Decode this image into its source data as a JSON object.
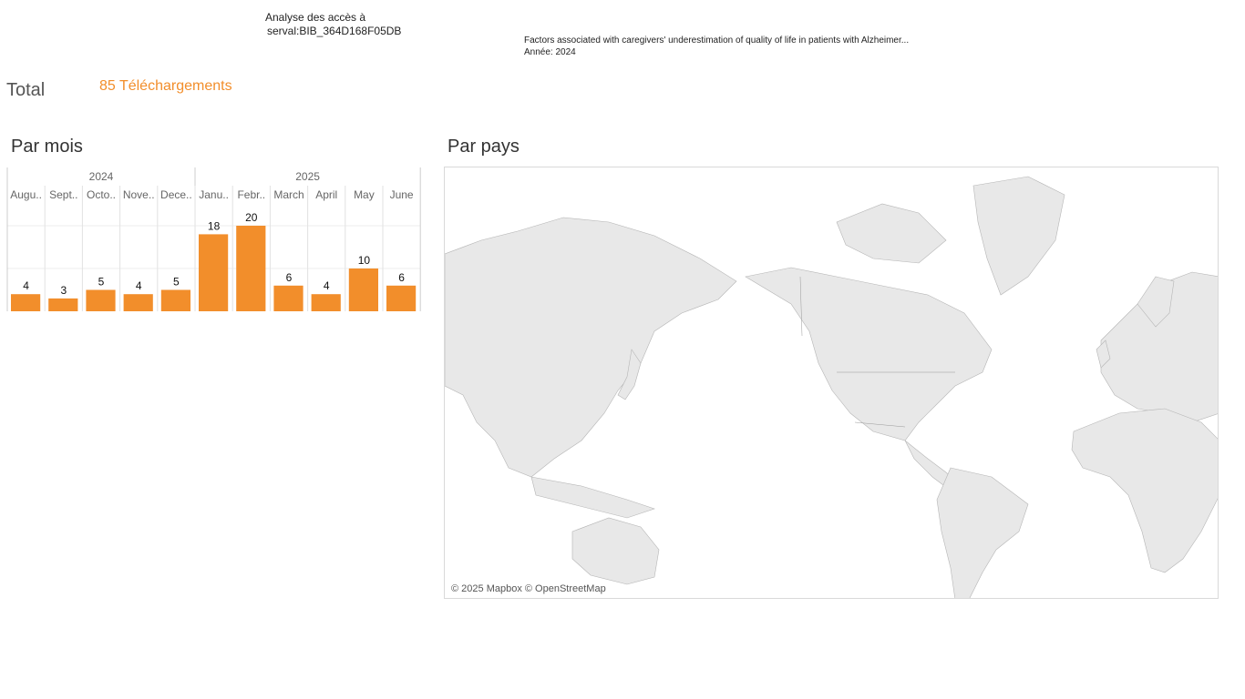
{
  "header": {
    "title_line1": "Analyse des accès à",
    "title_line2": "serval:BIB_364D168F05DB",
    "publication_title": "Factors associated with caregivers' underestimation of quality of life in patients with Alzheimer...",
    "publication_year": "Année: 2024"
  },
  "total": {
    "label": "Total",
    "value": "85 Téléchargements"
  },
  "sections": {
    "by_month": "Par mois",
    "by_country": "Par pays"
  },
  "map": {
    "attribution": "© 2025 Mapbox © OpenStreetMap",
    "land_color": "#e8e8e8",
    "border_color": "#a0a0a0"
  },
  "colors": {
    "bar": "#F28E2B",
    "accent_text": "#F28E2B"
  },
  "chart_data": {
    "type": "bar",
    "years": [
      {
        "label": "2024",
        "span": 5
      },
      {
        "label": "2025",
        "span": 6
      }
    ],
    "categories": [
      "Augu..",
      "Sept..",
      "Octo..",
      "Nove..",
      "Dece..",
      "Janu..",
      "Febr..",
      "March",
      "April",
      "May",
      "June"
    ],
    "values": [
      4,
      3,
      5,
      4,
      5,
      18,
      20,
      6,
      4,
      10,
      6
    ],
    "title": "",
    "xlabel": "",
    "ylabel": "",
    "ylim": [
      0,
      20
    ],
    "grid": true
  }
}
